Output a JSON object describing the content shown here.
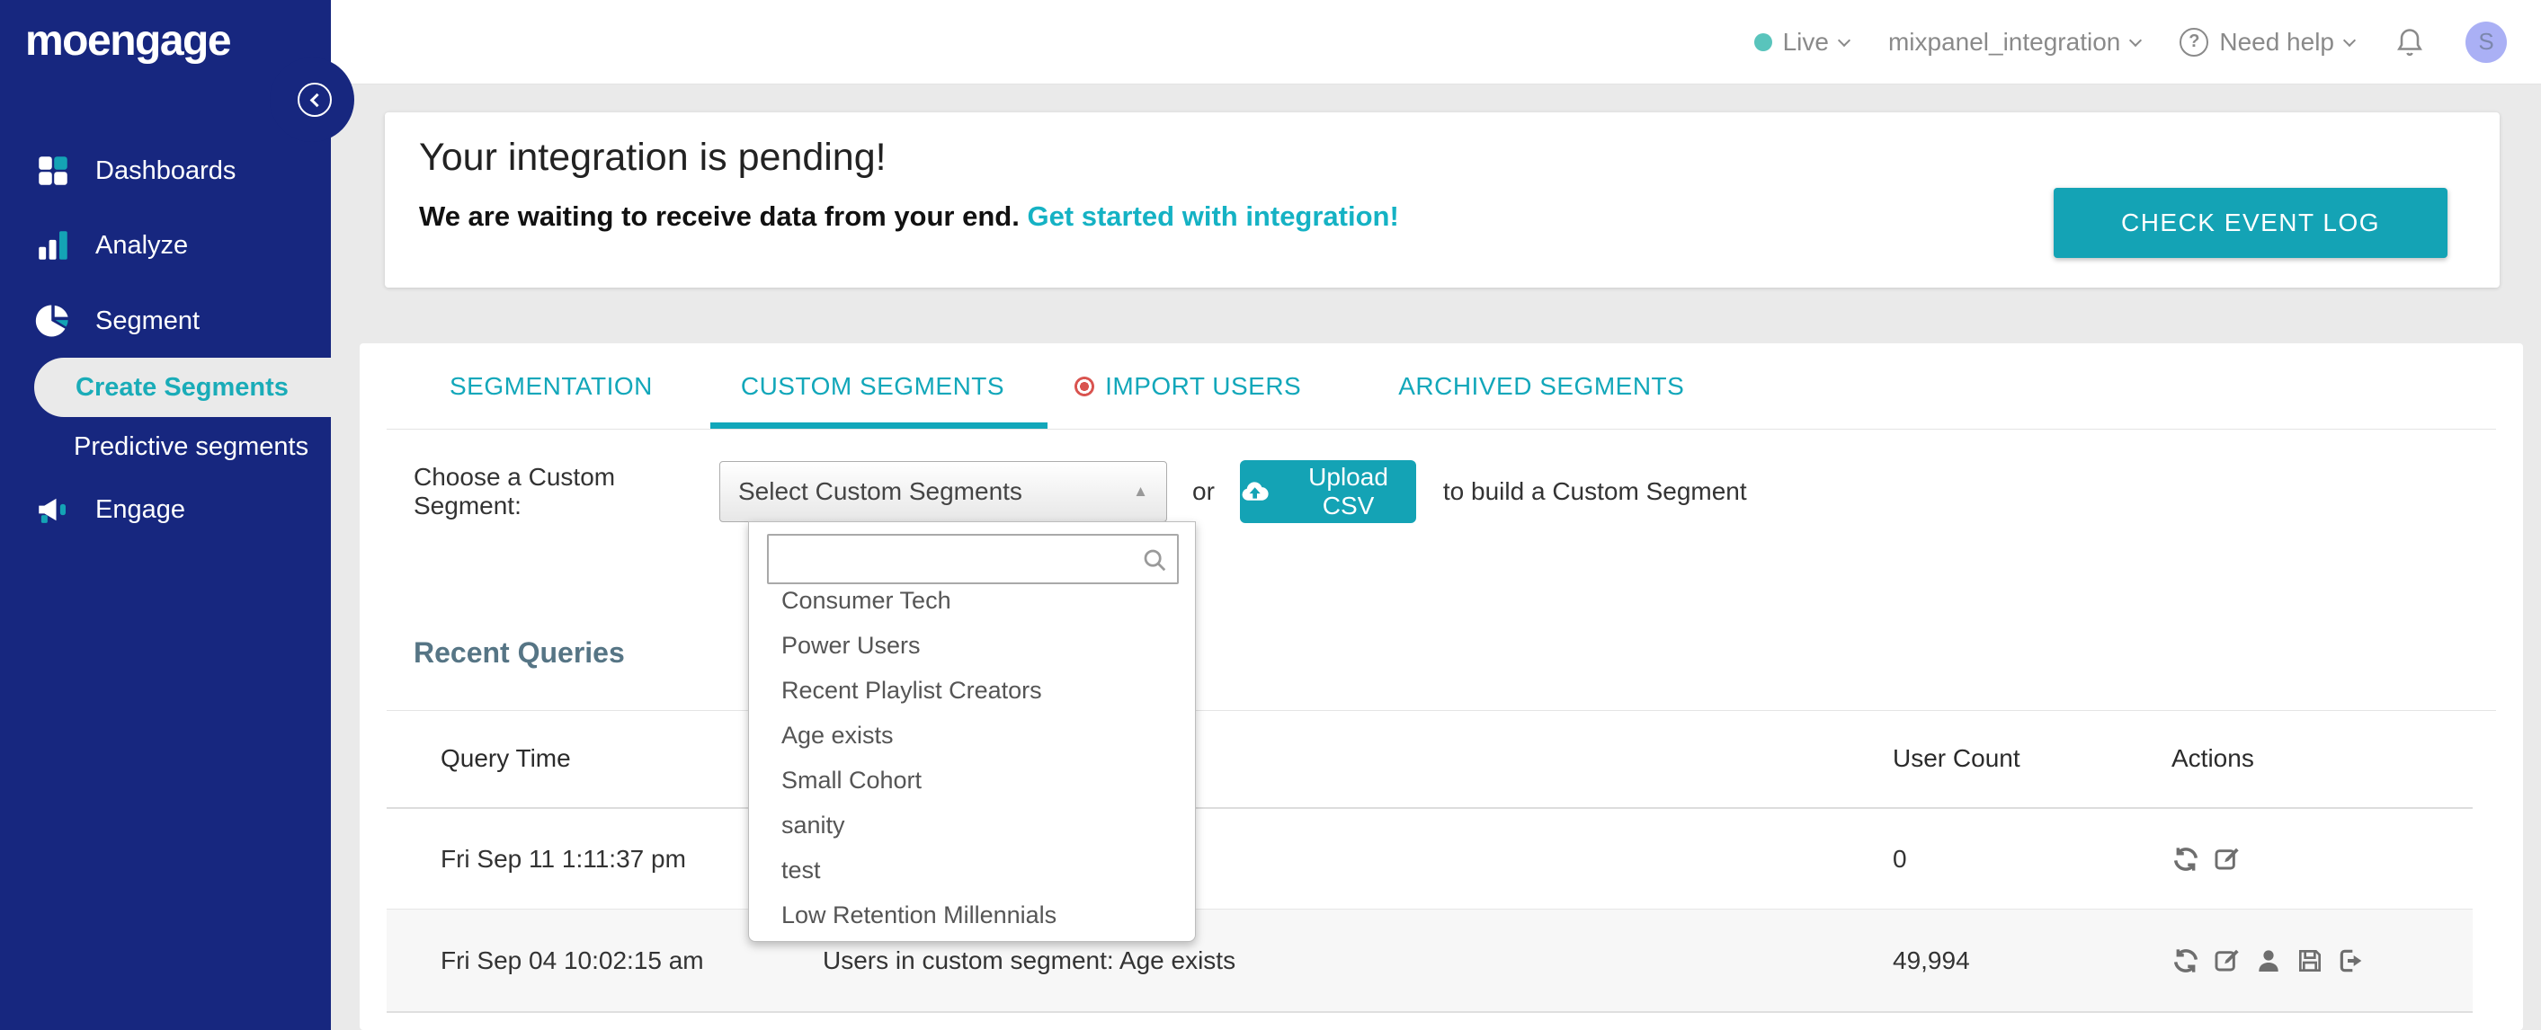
{
  "brand": {
    "logo_text": "moengage"
  },
  "topbar": {
    "environment": "Live",
    "app_name": "mixpanel_integration",
    "help_label": "Need help",
    "avatar_initial": "S"
  },
  "sidebar": {
    "items": [
      {
        "label": "Dashboards"
      },
      {
        "label": "Analyze"
      },
      {
        "label": "Segment"
      },
      {
        "label": "Create Segments",
        "active": true
      },
      {
        "label": "Predictive segments"
      },
      {
        "label": "Engage"
      }
    ]
  },
  "banner": {
    "title": "Your integration is pending!",
    "message": "We are waiting to receive data from your end. ",
    "link_label": "Get started with integration!",
    "button_label": "CHECK EVENT LOG"
  },
  "tabs": [
    {
      "label": "SEGMENTATION"
    },
    {
      "label": "CUSTOM SEGMENTS",
      "active": true
    },
    {
      "label": "IMPORT USERS",
      "badge": "red-dot"
    },
    {
      "label": "ARCHIVED SEGMENTS"
    }
  ],
  "controls": {
    "label": "Choose a Custom Segment:",
    "select_value": "Select Custom Segments",
    "or_text": "or",
    "upload_button": "Upload CSV",
    "suffix_text": "to build a Custom Segment"
  },
  "dropdown": {
    "search_value": "",
    "options": [
      "Consumer Tech",
      "Power Users",
      "Recent Playlist Creators",
      "Age exists",
      "Small Cohort",
      "sanity",
      "test",
      "Low Retention Millennials"
    ]
  },
  "recent_queries": {
    "title": "Recent Queries",
    "columns": {
      "time": "Query Time",
      "query": "",
      "count": "User Count",
      "actions": "Actions"
    },
    "rows": [
      {
        "time": "Fri Sep 11 1:11:37 pm",
        "query": "",
        "user_count": "0",
        "actions": [
          "refresh-icon",
          "edit-icon"
        ]
      },
      {
        "time": "Fri Sep 04 10:02:15 am",
        "query": "Users in custom segment: Age exists",
        "user_count": "49,994",
        "actions": [
          "refresh-icon",
          "edit-icon",
          "user-icon",
          "save-icon",
          "export-icon"
        ]
      }
    ]
  },
  "colors": {
    "navy": "#17277F",
    "teal_button": "#14A3B5",
    "teal_text": "#12A7BA",
    "teal_link": "#15B2C4",
    "heading_slate": "#567585",
    "red_dot": "#D9534F",
    "live_dot": "#59C4BC",
    "avatar_bg": "#AAB0F5",
    "page_bg": "#EAEAEA",
    "row_alt": "#F7F7F7"
  }
}
